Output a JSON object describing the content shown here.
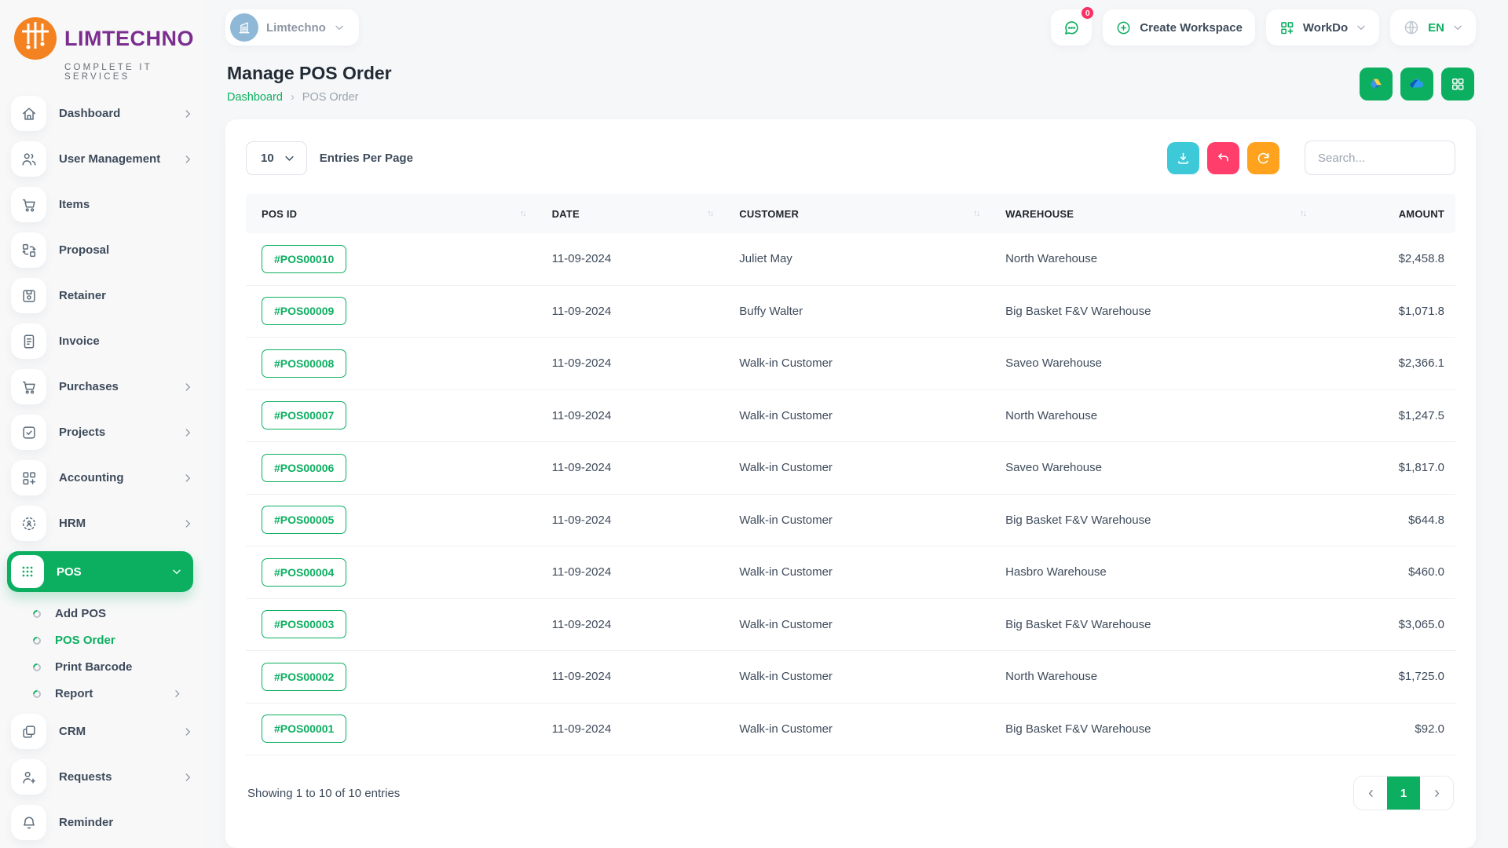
{
  "colors": {
    "accent_green": "#0caf60",
    "cyan_button": "#3ec9d8",
    "pink_button": "#ff3e6c",
    "orange_button": "#ffa21d",
    "badge_red": "#fd2e62",
    "brand_purple": "#7b2e8e",
    "brand_orange": "#f58220"
  },
  "brand": {
    "name": "LIMTECHNO",
    "tagline": "COMPLETE IT SERVICES"
  },
  "workspace": {
    "name": "Limtechno"
  },
  "topbar": {
    "chat_badge": "0",
    "create_workspace": "Create Workspace",
    "workdo": "WorkDo",
    "language": "EN"
  },
  "page": {
    "title": "Manage POS Order",
    "breadcrumb_root": "Dashboard",
    "breadcrumb_current": "POS Order"
  },
  "sidebar": {
    "items": [
      {
        "label": "Dashboard"
      },
      {
        "label": "User Management"
      },
      {
        "label": "Items"
      },
      {
        "label": "Proposal"
      },
      {
        "label": "Retainer"
      },
      {
        "label": "Invoice"
      },
      {
        "label": "Purchases"
      },
      {
        "label": "Projects"
      },
      {
        "label": "Accounting"
      },
      {
        "label": "HRM"
      },
      {
        "label": "POS"
      }
    ],
    "pos_children": [
      {
        "label": "Add POS"
      },
      {
        "label": "POS Order"
      },
      {
        "label": "Print Barcode"
      },
      {
        "label": "Report"
      }
    ],
    "items_bottom": [
      {
        "label": "CRM"
      },
      {
        "label": "Requests"
      },
      {
        "label": "Reminder"
      }
    ]
  },
  "controls": {
    "entries_value": "10",
    "entries_label": "Entries Per Page",
    "search_placeholder": "Search..."
  },
  "table": {
    "columns": [
      "POS ID",
      "DATE",
      "CUSTOMER",
      "WAREHOUSE",
      "AMOUNT"
    ],
    "rows": [
      {
        "pos_id": "#POS00010",
        "date": "11-09-2024",
        "customer": "Juliet May",
        "warehouse": "North Warehouse",
        "amount": "$2,458.8"
      },
      {
        "pos_id": "#POS00009",
        "date": "11-09-2024",
        "customer": "Buffy Walter",
        "warehouse": "Big Basket F&V Warehouse",
        "amount": "$1,071.8"
      },
      {
        "pos_id": "#POS00008",
        "date": "11-09-2024",
        "customer": "Walk-in Customer",
        "warehouse": "Saveo Warehouse",
        "amount": "$2,366.1"
      },
      {
        "pos_id": "#POS00007",
        "date": "11-09-2024",
        "customer": "Walk-in Customer",
        "warehouse": "North Warehouse",
        "amount": "$1,247.5"
      },
      {
        "pos_id": "#POS00006",
        "date": "11-09-2024",
        "customer": "Walk-in Customer",
        "warehouse": "Saveo Warehouse",
        "amount": "$1,817.0"
      },
      {
        "pos_id": "#POS00005",
        "date": "11-09-2024",
        "customer": "Walk-in Customer",
        "warehouse": "Big Basket F&V Warehouse",
        "amount": "$644.8"
      },
      {
        "pos_id": "#POS00004",
        "date": "11-09-2024",
        "customer": "Walk-in Customer",
        "warehouse": "Hasbro Warehouse",
        "amount": "$460.0"
      },
      {
        "pos_id": "#POS00003",
        "date": "11-09-2024",
        "customer": "Walk-in Customer",
        "warehouse": "Big Basket F&V Warehouse",
        "amount": "$3,065.0"
      },
      {
        "pos_id": "#POS00002",
        "date": "11-09-2024",
        "customer": "Walk-in Customer",
        "warehouse": "North Warehouse",
        "amount": "$1,725.0"
      },
      {
        "pos_id": "#POS00001",
        "date": "11-09-2024",
        "customer": "Walk-in Customer",
        "warehouse": "Big Basket F&V Warehouse",
        "amount": "$92.0"
      }
    ]
  },
  "footer": {
    "showing": "Showing 1 to 10 of 10 entries",
    "page": "1"
  }
}
